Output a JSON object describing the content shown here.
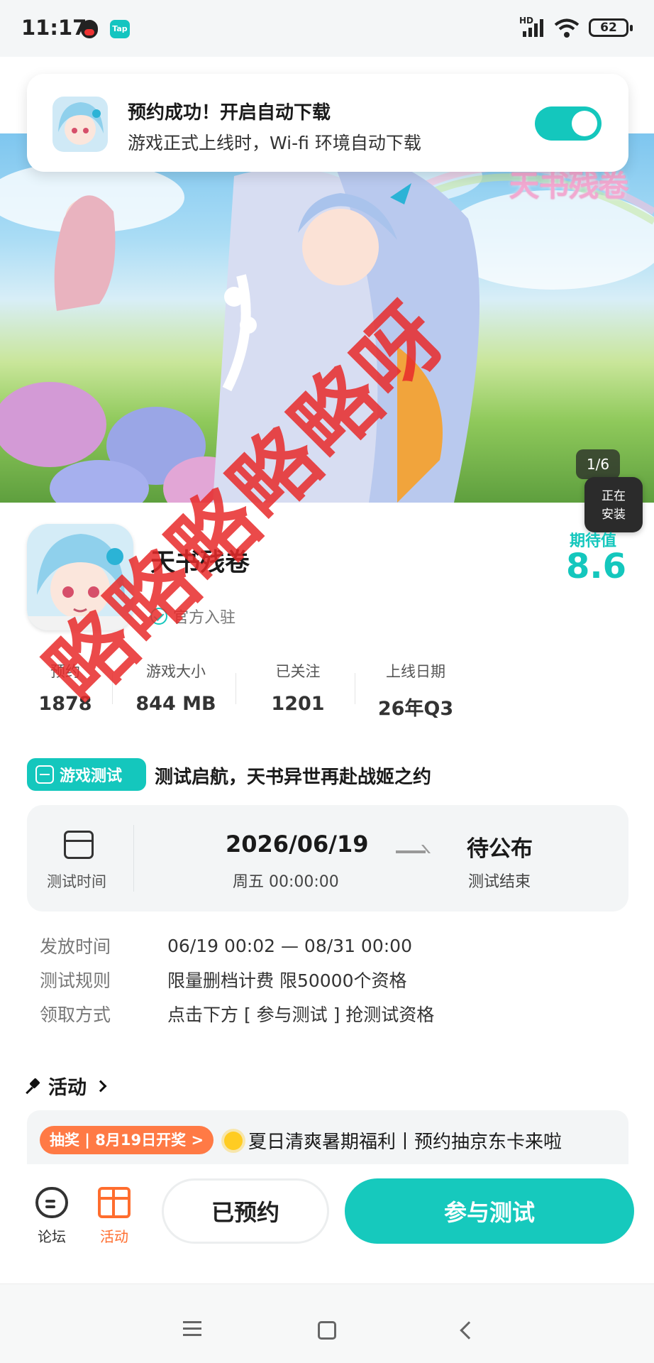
{
  "status_bar": {
    "time": "11:17",
    "network_type": "HD",
    "battery_level": "62",
    "icons": [
      "qq-icon",
      "taptap-icon",
      "signal-icon",
      "wifi-icon",
      "battery-icon"
    ]
  },
  "toast": {
    "title": "预约成功！开启自动下载",
    "description": "游戏正式上线时，Wi-fi 环境自动下载",
    "auto_download_on": true
  },
  "banner": {
    "logo_text": "天书残卷",
    "counter": "1/6"
  },
  "installing": {
    "line1": "正在",
    "line2": "安装"
  },
  "game": {
    "name": "天书残卷",
    "official_label": "官方入驻",
    "rating_label": "期待值",
    "rating_value": "8.6"
  },
  "stats": [
    {
      "label": "预约",
      "value": "1878"
    },
    {
      "label": "游戏大小",
      "value": "844 MB"
    },
    {
      "label": "已关注",
      "value": "1201"
    },
    {
      "label": "上线日期",
      "value": "26年Q3"
    }
  ],
  "test": {
    "badge": "游戏测试",
    "headline": "测试启航，天书异世再赴战姬之约",
    "time_label": "测试时间",
    "start_date": "2026/06/19",
    "start_time": "周五  00:00:00",
    "end_status": "待公布",
    "end_label": "测试结束",
    "info": [
      {
        "key": "发放时间",
        "value": "06/19 00:02 — 08/31 00:00"
      },
      {
        "key": "测试规则",
        "value": "限量删档计费 限50000个资格"
      },
      {
        "key": "领取方式",
        "value": "点击下方 [ 参与测试 ] 抢测试资格"
      }
    ]
  },
  "activity": {
    "header": "活动",
    "pill": "抽奖 | 8月19日开奖 >",
    "text": "夏日清爽暑期福利丨预约抽京东卡来啦"
  },
  "action_bar": {
    "forum": "论坛",
    "activity": "活动",
    "reserved": "已预约",
    "join": "参与测试"
  },
  "watermark": "略略略略略呀",
  "colors": {
    "accent": "#16c9bd",
    "orange": "#ff6d2e",
    "watermark": "#e82a2a"
  }
}
